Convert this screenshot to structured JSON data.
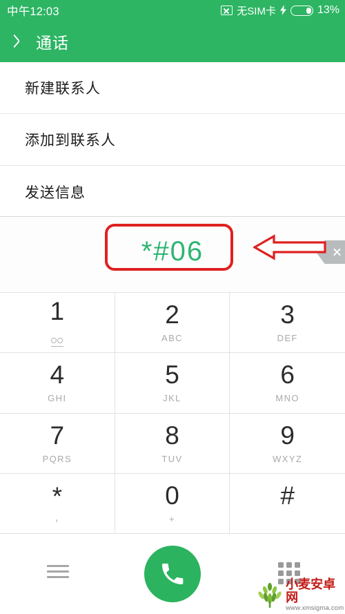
{
  "status_bar": {
    "time": "中午12:03",
    "sim_status": "无SIM卡",
    "sim_icon": "sim-card-x-icon",
    "charging_icon": "lightning-bolt-icon",
    "battery_icon": "battery-icon",
    "battery_percent": "13%",
    "background_color": "#2db563",
    "text_color": "#ffffff"
  },
  "app_bar": {
    "back_icon": "chevron-left-icon",
    "title": "通话",
    "background_color": "#2db563"
  },
  "menu": {
    "items": [
      {
        "label": "新建联系人"
      },
      {
        "label": "添加到联系人"
      },
      {
        "label": "发送信息"
      }
    ]
  },
  "dialer": {
    "number": "*#06",
    "number_color": "#2db572",
    "backspace_icon": "backspace-icon"
  },
  "keypad": {
    "keys": [
      {
        "digit": "1",
        "sub": "",
        "sub_icon": "voicemail-icon"
      },
      {
        "digit": "2",
        "sub": "ABC",
        "sub_icon": ""
      },
      {
        "digit": "3",
        "sub": "DEF",
        "sub_icon": ""
      },
      {
        "digit": "4",
        "sub": "GHI",
        "sub_icon": ""
      },
      {
        "digit": "5",
        "sub": "JKL",
        "sub_icon": ""
      },
      {
        "digit": "6",
        "sub": "MNO",
        "sub_icon": ""
      },
      {
        "digit": "7",
        "sub": "PQRS",
        "sub_icon": ""
      },
      {
        "digit": "8",
        "sub": "TUV",
        "sub_icon": ""
      },
      {
        "digit": "9",
        "sub": "WXYZ",
        "sub_icon": ""
      },
      {
        "digit": "*",
        "sub": ",",
        "sub_icon": ""
      },
      {
        "digit": "0",
        "sub": "+",
        "sub_icon": ""
      },
      {
        "digit": "#",
        "sub": "",
        "sub_icon": ""
      }
    ]
  },
  "bottom_bar": {
    "menu_icon": "hamburger-menu-icon",
    "call_icon": "phone-handset-icon",
    "call_button_color": "#2bb35f",
    "dialpad_icon": "dialpad-dots-icon"
  },
  "annotations": {
    "highlight_box_color": "#e02020",
    "arrow_color": "#e02020",
    "arrow_icon": "arrow-left-icon",
    "highlight_target": "*#06",
    "arrow_target": "backspace-icon"
  },
  "watermark": {
    "logo_icon": "wheat-logo-icon",
    "site_name": "小麦安卓网",
    "site_url": "www.xmsigma.com",
    "name_color": "#c21b17"
  }
}
